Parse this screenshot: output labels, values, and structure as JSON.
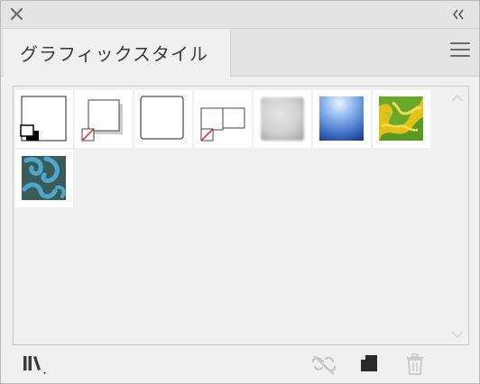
{
  "panel": {
    "tab_label": "グラフィックスタイル",
    "close_icon": "close-icon",
    "collapse_icon": "double-chevron-left-icon",
    "menu_icon": "hamburger-menu-icon"
  },
  "styles": [
    {
      "name": "default-graphic-style",
      "kind": "default"
    },
    {
      "name": "default-character-style",
      "kind": "shadow-none"
    },
    {
      "name": "rounded-rectangle-style",
      "kind": "plain"
    },
    {
      "name": "double-frame-style",
      "kind": "double-none"
    },
    {
      "name": "soft-gray-gradient-style",
      "kind": "gray"
    },
    {
      "name": "blue-radial-gradient-style",
      "kind": "blue"
    },
    {
      "name": "yellow-green-pattern-style",
      "kind": "yellow"
    },
    {
      "name": "teal-swirl-pattern-style",
      "kind": "teal"
    }
  ],
  "toolbar": {
    "library_icon": "graphic-style-libraries-icon",
    "unlink_icon": "break-link-icon",
    "new_icon": "new-graphic-style-icon",
    "delete_icon": "trash-icon"
  }
}
